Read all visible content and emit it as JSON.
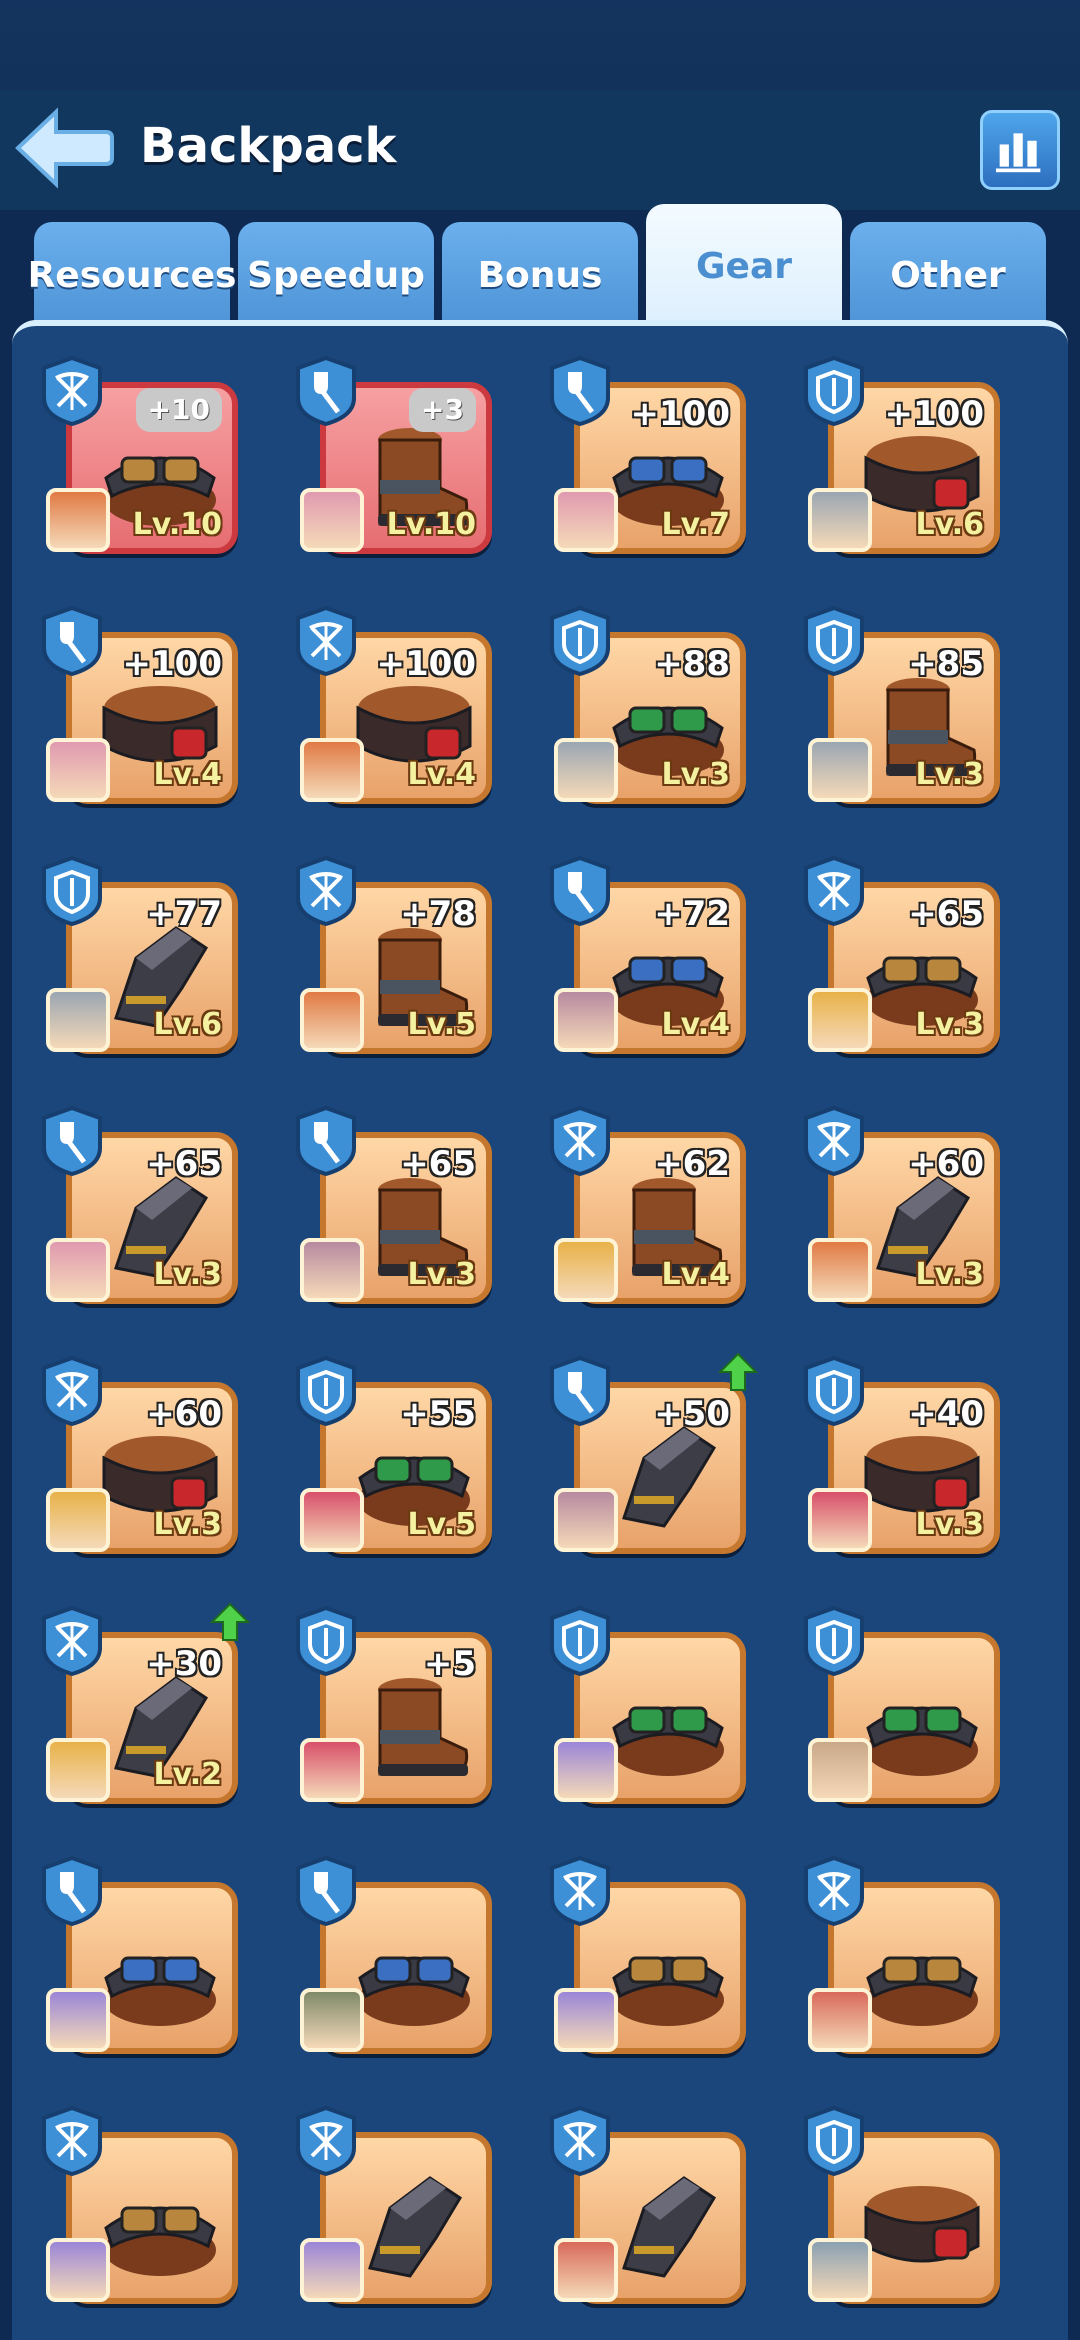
{
  "header": {
    "title": "Backpack"
  },
  "tabs": [
    {
      "label": "Resources",
      "active": false
    },
    {
      "label": "Speedup",
      "active": false
    },
    {
      "label": "Bonus",
      "active": false
    },
    {
      "label": "Gear",
      "active": true
    },
    {
      "label": "Other",
      "active": false
    }
  ],
  "colors": {
    "accent": "#4b8fd0",
    "card_border": "#c6772e",
    "card_red_border": "#cc3a40"
  },
  "items": [
    {
      "class": "crossbow",
      "gear": "goggles",
      "bonus": "+10",
      "pill": true,
      "level": "Lv.10",
      "red": true,
      "avatar": "#e07a45",
      "upgrade": false
    },
    {
      "class": "shovel",
      "gear": "boot",
      "bonus": "+3",
      "pill": true,
      "level": "Lv.10",
      "red": true,
      "avatar": "#e09ab0",
      "upgrade": false
    },
    {
      "class": "shovel",
      "gear": "goggles-blue",
      "bonus": "+100",
      "pill": false,
      "level": "Lv.7",
      "red": false,
      "avatar": "#e09ab0",
      "upgrade": false
    },
    {
      "class": "shield",
      "gear": "belt",
      "bonus": "+100",
      "pill": false,
      "level": "Lv.6",
      "red": false,
      "avatar": "#9aa6b2",
      "upgrade": false
    },
    {
      "class": "shovel",
      "gear": "belt",
      "bonus": "+100",
      "pill": false,
      "level": "Lv.4",
      "red": false,
      "avatar": "#e09ab0",
      "upgrade": false
    },
    {
      "class": "crossbow",
      "gear": "belt",
      "bonus": "+100",
      "pill": false,
      "level": "Lv.4",
      "red": false,
      "avatar": "#e07a45",
      "upgrade": false
    },
    {
      "class": "shield",
      "gear": "goggles-green",
      "bonus": "+88",
      "pill": false,
      "level": "Lv.3",
      "red": false,
      "avatar": "#9aa6b2",
      "upgrade": false
    },
    {
      "class": "shield",
      "gear": "boot",
      "bonus": "+85",
      "pill": false,
      "level": "Lv.3",
      "red": false,
      "avatar": "#9aa6b2",
      "upgrade": false
    },
    {
      "class": "shield",
      "gear": "glove",
      "bonus": "+77",
      "pill": false,
      "level": "Lv.6",
      "red": false,
      "avatar": "#9aa6b2",
      "upgrade": false
    },
    {
      "class": "crossbow",
      "gear": "boot",
      "bonus": "+78",
      "pill": false,
      "level": "Lv.5",
      "red": false,
      "avatar": "#e07a45",
      "upgrade": false
    },
    {
      "class": "shovel",
      "gear": "goggles-blue",
      "bonus": "+72",
      "pill": false,
      "level": "Lv.4",
      "red": false,
      "avatar": "#b78aa0",
      "upgrade": false
    },
    {
      "class": "crossbow",
      "gear": "goggles",
      "bonus": "+65",
      "pill": false,
      "level": "Lv.3",
      "red": false,
      "avatar": "#e8b24a",
      "upgrade": false
    },
    {
      "class": "shovel",
      "gear": "glove",
      "bonus": "+65",
      "pill": false,
      "level": "Lv.3",
      "red": false,
      "avatar": "#e09ab0",
      "upgrade": false
    },
    {
      "class": "shovel",
      "gear": "boot",
      "bonus": "+65",
      "pill": false,
      "level": "Lv.3",
      "red": false,
      "avatar": "#b78aa0",
      "upgrade": false
    },
    {
      "class": "crossbow",
      "gear": "boot",
      "bonus": "+62",
      "pill": false,
      "level": "Lv.4",
      "red": false,
      "avatar": "#e8b24a",
      "upgrade": false
    },
    {
      "class": "crossbow",
      "gear": "glove",
      "bonus": "+60",
      "pill": false,
      "level": "Lv.3",
      "red": false,
      "avatar": "#e07a45",
      "upgrade": false
    },
    {
      "class": "crossbow",
      "gear": "belt",
      "bonus": "+60",
      "pill": false,
      "level": "Lv.3",
      "red": false,
      "avatar": "#e8b24a",
      "upgrade": false
    },
    {
      "class": "shield",
      "gear": "goggles-green",
      "bonus": "+55",
      "pill": false,
      "level": "Lv.5",
      "red": false,
      "avatar": "#d8506a",
      "upgrade": false
    },
    {
      "class": "shovel",
      "gear": "glove",
      "bonus": "+50",
      "pill": false,
      "level": "",
      "red": false,
      "avatar": "#b78aa0",
      "upgrade": true
    },
    {
      "class": "shield",
      "gear": "belt",
      "bonus": "+40",
      "pill": false,
      "level": "Lv.3",
      "red": false,
      "avatar": "#d8506a",
      "upgrade": false
    },
    {
      "class": "crossbow",
      "gear": "glove",
      "bonus": "+30",
      "pill": false,
      "level": "Lv.2",
      "red": false,
      "avatar": "#e8b24a",
      "upgrade": true
    },
    {
      "class": "shield",
      "gear": "boot",
      "bonus": "+5",
      "pill": false,
      "level": "",
      "red": false,
      "avatar": "#d8506a",
      "upgrade": false
    },
    {
      "class": "shield",
      "gear": "goggles-green",
      "bonus": "",
      "pill": false,
      "level": "",
      "red": false,
      "avatar": "#9a86d8",
      "upgrade": false
    },
    {
      "class": "shield",
      "gear": "goggles-green",
      "bonus": "",
      "pill": false,
      "level": "",
      "red": false,
      "avatar": "#c9a88a",
      "upgrade": false
    },
    {
      "class": "shovel",
      "gear": "goggles-blue",
      "bonus": "",
      "pill": false,
      "level": "",
      "red": false,
      "avatar": "#9a86d8",
      "upgrade": false
    },
    {
      "class": "shovel",
      "gear": "goggles-blue",
      "bonus": "",
      "pill": false,
      "level": "",
      "red": false,
      "avatar": "#7f8a6a",
      "upgrade": false
    },
    {
      "class": "crossbow",
      "gear": "goggles",
      "bonus": "",
      "pill": false,
      "level": "",
      "red": false,
      "avatar": "#9a86d8",
      "upgrade": false
    },
    {
      "class": "crossbow",
      "gear": "goggles",
      "bonus": "",
      "pill": false,
      "level": "",
      "red": false,
      "avatar": "#d86a5a",
      "upgrade": false
    },
    {
      "class": "crossbow",
      "gear": "goggles",
      "bonus": "",
      "pill": false,
      "level": "",
      "red": false,
      "avatar": "#9a86d8",
      "upgrade": false
    },
    {
      "class": "crossbow",
      "gear": "glove",
      "bonus": "",
      "pill": false,
      "level": "",
      "red": false,
      "avatar": "#9a86d8",
      "upgrade": false
    },
    {
      "class": "crossbow",
      "gear": "glove",
      "bonus": "",
      "pill": false,
      "level": "",
      "red": false,
      "avatar": "#d86a5a",
      "upgrade": false
    },
    {
      "class": "shield",
      "gear": "belt",
      "bonus": "",
      "pill": false,
      "level": "",
      "red": false,
      "avatar": "#8aa0b2",
      "upgrade": false
    }
  ]
}
